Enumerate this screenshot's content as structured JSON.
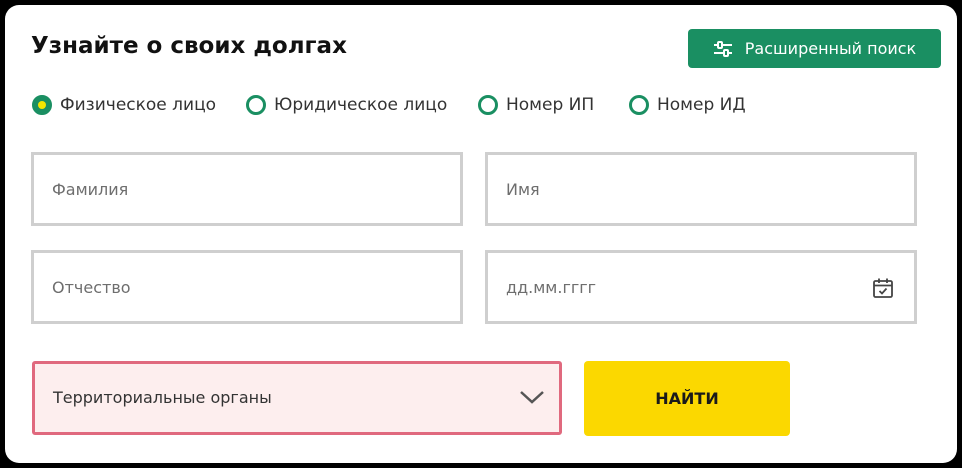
{
  "header": {
    "title": "Узнайте о своих долгах"
  },
  "advanced_search": {
    "label": "Расширенный поиск",
    "icon": "sliders-icon"
  },
  "search_type": {
    "options": [
      {
        "label": "Физическое лицо",
        "checked": true
      },
      {
        "label": "Юридическое лицо",
        "checked": false
      },
      {
        "label": "Номер ИП",
        "checked": false
      },
      {
        "label": "Номер ИД",
        "checked": false
      }
    ]
  },
  "form": {
    "last_name_placeholder": "Фамилия",
    "first_name_placeholder": "Имя",
    "patronymic_placeholder": "Отчество",
    "birth_date_placeholder": "дд.мм.гггг",
    "birth_date_icon": "calendar-icon",
    "territorial_select": {
      "value": "Территориальные органы",
      "icon": "chevron-down-icon"
    },
    "submit_label": "НАЙТИ"
  },
  "colors": {
    "accent_green": "#1a8f62",
    "radio_dot": "#f2e600",
    "submit_yellow": "#fbd800",
    "select_error_border": "#e0697e",
    "select_error_bg": "#fdeeee",
    "field_border": "#cfcfcf"
  }
}
